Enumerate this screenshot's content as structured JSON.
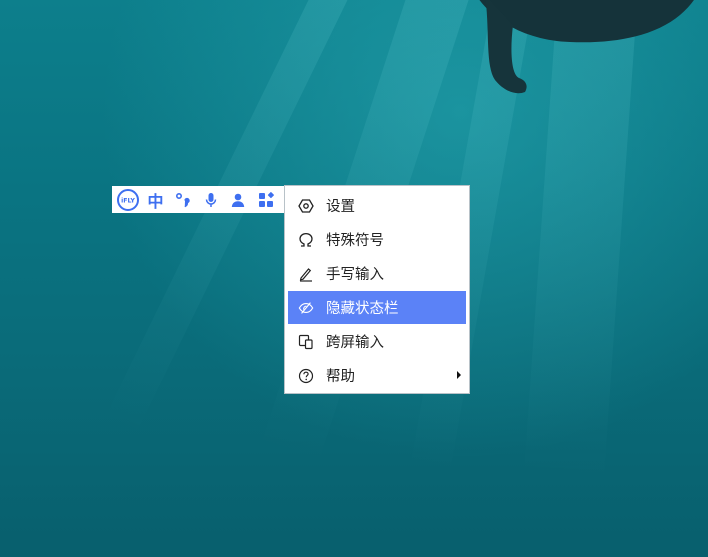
{
  "ime_toolbar": {
    "logo_text": "iFLY",
    "language_label": "中"
  },
  "context_menu": {
    "items": [
      {
        "label": "设置",
        "icon": "settings-icon"
      },
      {
        "label": "特殊符号",
        "icon": "omega-icon"
      },
      {
        "label": "手写输入",
        "icon": "pen-icon"
      },
      {
        "label": "隐藏状态栏",
        "icon": "hide-icon",
        "selected": true
      },
      {
        "label": "跨屏输入",
        "icon": "cross-screen-icon"
      },
      {
        "label": "帮助",
        "icon": "help-icon",
        "has_submenu": true
      }
    ]
  },
  "colors": {
    "accent": "#3e6ff0",
    "menu_highlight": "#5b82f7",
    "water": "#0a7482"
  }
}
